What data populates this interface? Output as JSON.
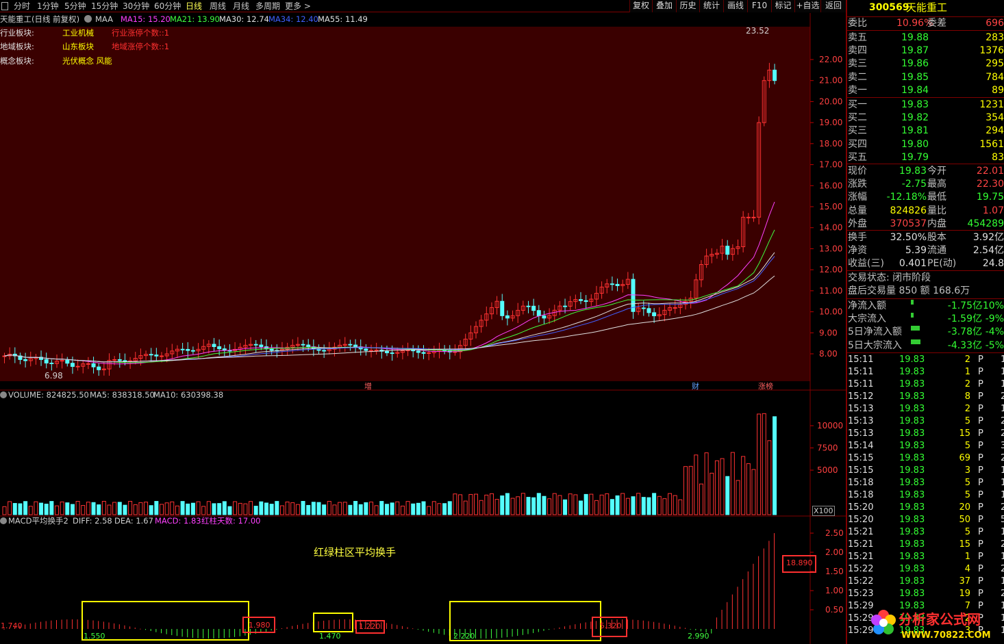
{
  "toolbar": {
    "periods": [
      "分时",
      "1分钟",
      "5分钟",
      "15分钟",
      "30分钟",
      "60分钟",
      "日线",
      "周线",
      "月线",
      "多周期",
      "更多 >"
    ],
    "active_period": "日线",
    "buttons": [
      "复权",
      "叠加",
      "历史",
      "统计",
      "画线",
      "F10",
      "标记",
      "+自选",
      "返回"
    ]
  },
  "main_chart": {
    "stock_label": "天能重工(日线 前复权)",
    "indicator_name": "MAA",
    "ma": [
      {
        "label": "MA15: 15.20",
        "color": "#ff40ff"
      },
      {
        "label": "MA21: 13.90",
        "color": "#40ff40"
      },
      {
        "label": "MA30: 12.74",
        "color": "#e0e0e0"
      },
      {
        "label": "MA34: 12.40",
        "color": "#4060ff"
      },
      {
        "label": "MA55: 11.49",
        "color": "#e0e0e0"
      }
    ],
    "sector_rows": [
      {
        "label": "行业板块:",
        "value": "工业机械",
        "extra": "行业涨停个数::1"
      },
      {
        "label": "地域板块:",
        "value": "山东板块",
        "extra": "地域涨停个数::1"
      },
      {
        "label": "概念板块:",
        "value": "光伏概念 风能",
        "extra": ""
      }
    ],
    "y_ticks": [
      "22.00",
      "21.00",
      "20.00",
      "19.00",
      "18.00",
      "17.00",
      "16.00",
      "15.00",
      "14.00",
      "13.00",
      "12.00",
      "11.00",
      "10.00",
      "9.00",
      "8.00"
    ],
    "high_label": "23.52",
    "low_label": "6.98",
    "markers": [
      "增",
      "财",
      "涨榜"
    ]
  },
  "volume_chart": {
    "legend": [
      {
        "label": "VOLUME: 824825.50",
        "color": "#d0d0d0"
      },
      {
        "label": "MA5: 838318.50",
        "color": "#d0d0d0"
      },
      {
        "label": "MA10: 630398.38",
        "color": "#d0d0d0"
      }
    ],
    "y_ticks": [
      "10000",
      "7500",
      "5000"
    ],
    "unit": "X100"
  },
  "macd_chart": {
    "legend": [
      {
        "label": "MACD平均换手2",
        "color": "#d0d0d0"
      },
      {
        "label": "DIFF: 2.58",
        "color": "#d0d0d0"
      },
      {
        "label": "DEA: 1.67",
        "color": "#d0d0d0"
      },
      {
        "label": "MACD: 1.83",
        "color": "#ff40ff"
      },
      {
        "label": "红柱天数: 17.00",
        "color": "#ff40ff"
      }
    ],
    "title_note": "红绿柱区平均换手",
    "y_ticks": [
      "2.50",
      "2.00",
      "1.50",
      "1.00",
      "0.50"
    ],
    "box_labels": [
      "1.980",
      "1.470",
      "1.220",
      "2.220",
      "5.320",
      "2.990",
      "18.890",
      "1.740",
      "1.550"
    ]
  },
  "quote": {
    "code": "300569",
    "name": "天能重工",
    "weibi_label": "委比",
    "weibi_value": "10.96%",
    "weicha_label": "委差",
    "weicha_value": "696",
    "sell": [
      {
        "label": "卖五",
        "price": "19.88",
        "vol": "283"
      },
      {
        "label": "卖四",
        "price": "19.87",
        "vol": "1376"
      },
      {
        "label": "卖三",
        "price": "19.86",
        "vol": "295"
      },
      {
        "label": "卖二",
        "price": "19.85",
        "vol": "784"
      },
      {
        "label": "卖一",
        "price": "19.84",
        "vol": "89"
      }
    ],
    "buy": [
      {
        "label": "买一",
        "price": "19.83",
        "vol": "1231"
      },
      {
        "label": "买二",
        "price": "19.82",
        "vol": "354"
      },
      {
        "label": "买三",
        "price": "19.81",
        "vol": "294"
      },
      {
        "label": "买四",
        "price": "19.80",
        "vol": "1561"
      },
      {
        "label": "买五",
        "price": "19.79",
        "vol": "83"
      }
    ],
    "stats": [
      {
        "l1": "现价",
        "v1": "19.83",
        "c1": "g",
        "l2": "今开",
        "v2": "22.01",
        "c2": "r"
      },
      {
        "l1": "涨跌",
        "v1": "-2.75",
        "c1": "g",
        "l2": "最高",
        "v2": "22.30",
        "c2": "r"
      },
      {
        "l1": "涨幅",
        "v1": "-12.18%",
        "c1": "g",
        "l2": "最低",
        "v2": "19.75",
        "c2": "g"
      },
      {
        "l1": "总量",
        "v1": "824826",
        "c1": "y",
        "l2": "量比",
        "v2": "1.07",
        "c2": "r"
      },
      {
        "l1": "外盘",
        "v1": "370537",
        "c1": "r",
        "l2": "内盘",
        "v2": "454289",
        "c2": "g"
      }
    ],
    "stats2": [
      {
        "l1": "换手",
        "v1": "32.50%",
        "c1": "w",
        "l2": "股本",
        "v2": "3.92亿",
        "c2": "w"
      },
      {
        "l1": "净资",
        "v1": "5.39",
        "c1": "w",
        "l2": "流通",
        "v2": "2.54亿",
        "c2": "w"
      },
      {
        "l1": "收益(三)",
        "v1": "0.401",
        "c1": "w",
        "l2": "PE(动)",
        "v2": "24.8",
        "c2": "w"
      }
    ],
    "trade_status": "交易状态: 闭市阶段",
    "after_hours": "盘后交易量 850 额 168.6万",
    "flows": [
      {
        "label": "净流入额",
        "value": "-1.75亿",
        "pct": "-10%",
        "bar": 4
      },
      {
        "label": "大宗流入",
        "value": "-1.59亿",
        "pct": "-9%",
        "bar": 4
      },
      {
        "label": "5日净流入额",
        "value": "-3.78亿",
        "pct": "-4%",
        "bar": 13
      },
      {
        "label": "5日大宗流入",
        "value": "-4.33亿",
        "pct": "-5%",
        "bar": 14
      }
    ],
    "ticks": [
      {
        "t": "15:11",
        "p": "19.83",
        "v": "2",
        "bs": "P",
        "n": "1"
      },
      {
        "t": "15:11",
        "p": "19.83",
        "v": "1",
        "bs": "P",
        "n": "1"
      },
      {
        "t": "15:11",
        "p": "19.83",
        "v": "2",
        "bs": "P",
        "n": "1"
      },
      {
        "t": "15:12",
        "p": "19.83",
        "v": "8",
        "bs": "P",
        "n": "2"
      },
      {
        "t": "15:13",
        "p": "19.83",
        "v": "2",
        "bs": "P",
        "n": "1"
      },
      {
        "t": "15:13",
        "p": "19.83",
        "v": "5",
        "bs": "P",
        "n": "2"
      },
      {
        "t": "15:13",
        "p": "19.83",
        "v": "15",
        "bs": "P",
        "n": "2"
      },
      {
        "t": "15:14",
        "p": "19.83",
        "v": "5",
        "bs": "P",
        "n": "3"
      },
      {
        "t": "15:15",
        "p": "19.83",
        "v": "69",
        "bs": "P",
        "n": "2"
      },
      {
        "t": "15:15",
        "p": "19.83",
        "v": "3",
        "bs": "P",
        "n": "1"
      },
      {
        "t": "15:18",
        "p": "19.83",
        "v": "5",
        "bs": "P",
        "n": "1"
      },
      {
        "t": "15:18",
        "p": "19.83",
        "v": "5",
        "bs": "P",
        "n": "1"
      },
      {
        "t": "15:20",
        "p": "19.83",
        "v": "20",
        "bs": "P",
        "n": "2"
      },
      {
        "t": "15:20",
        "p": "19.83",
        "v": "50",
        "bs": "P",
        "n": "5"
      },
      {
        "t": "15:21",
        "p": "19.83",
        "v": "5",
        "bs": "P",
        "n": "1"
      },
      {
        "t": "15:21",
        "p": "19.83",
        "v": "15",
        "bs": "P",
        "n": "2"
      },
      {
        "t": "15:21",
        "p": "19.83",
        "v": "1",
        "bs": "P",
        "n": "1"
      },
      {
        "t": "15:22",
        "p": "19.83",
        "v": "4",
        "bs": "P",
        "n": "2"
      },
      {
        "t": "15:22",
        "p": "19.83",
        "v": "37",
        "bs": "P",
        "n": "1"
      },
      {
        "t": "15:23",
        "p": "19.83",
        "v": "19",
        "bs": "P",
        "n": "2"
      },
      {
        "t": "15:29",
        "p": "19.83",
        "v": "7",
        "bs": "P",
        "n": "1"
      },
      {
        "t": "15:29",
        "p": "19.83",
        "v": "2",
        "bs": "P",
        "n": "1"
      },
      {
        "t": "15:29",
        "p": "19.83",
        "v": "3",
        "bs": "P",
        "n": "1"
      }
    ]
  },
  "watermark": {
    "name": "分析家公式网",
    "url": "WWW.70822.COM"
  },
  "colors": {
    "up": "#ff3232",
    "down": "#54ffff",
    "bg_main": "#3a0000",
    "grid": "#800000"
  }
}
